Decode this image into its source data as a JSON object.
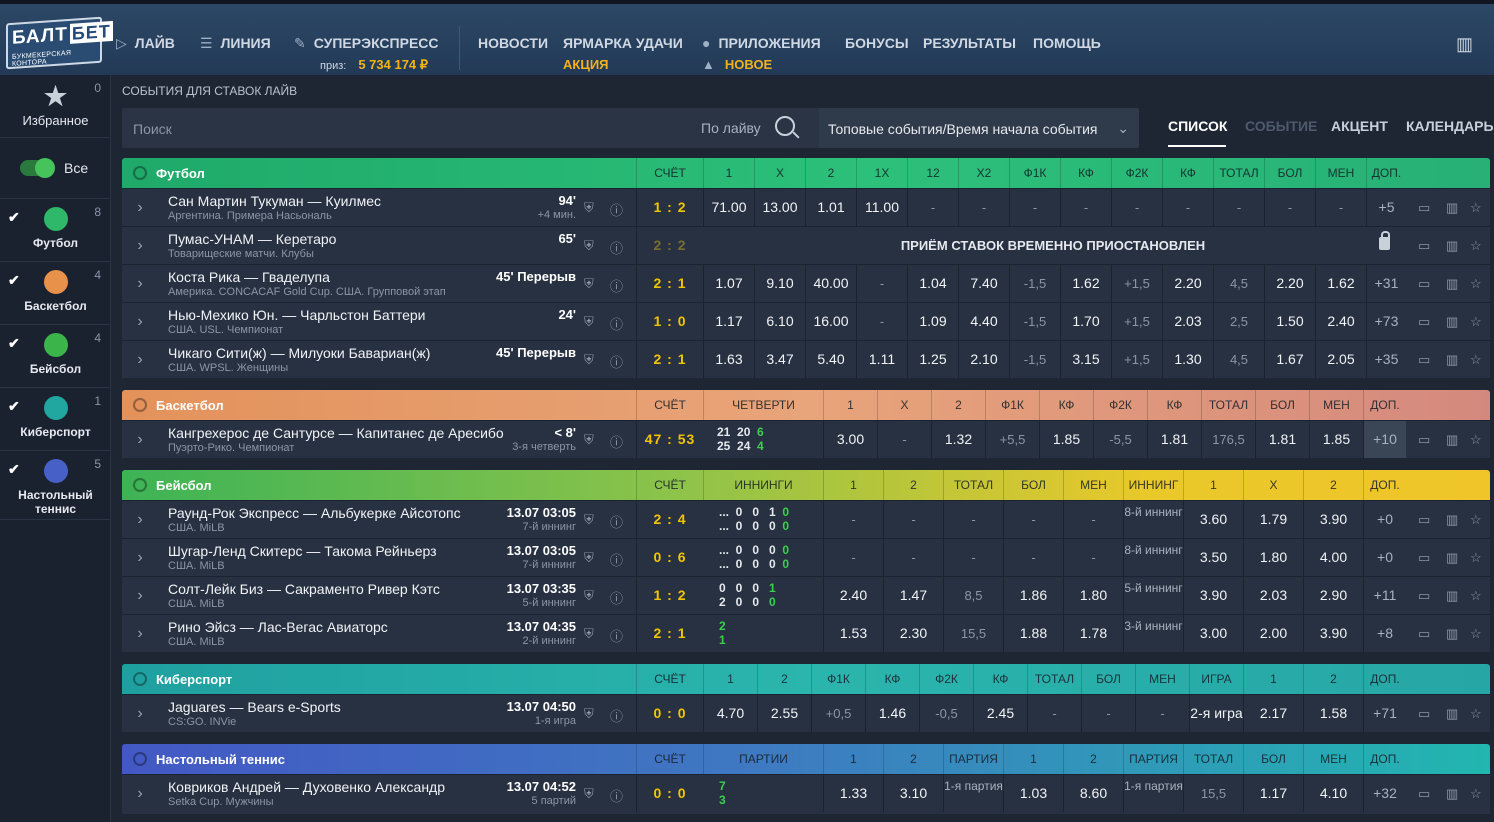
{
  "logo": {
    "word1": "БАЛТ",
    "word2": "БЕТ",
    "tagline": "БУКМЕКЕРСКАЯ КОНТОРА"
  },
  "nav": {
    "live": "ЛАЙВ",
    "line": "ЛИНИЯ",
    "superexpress": "СУПЕРЭКСПРЕСС",
    "prize_label": "приз:",
    "prize_value": "5 734 174 ₽",
    "news": "НОВОСТИ",
    "fair": "ЯРМАРКА УДАЧИ",
    "fair_sub": "АКЦИЯ",
    "apps": "ПРИЛОЖЕНИЯ",
    "apps_sub": "НОВОЕ",
    "bonuses": "БОНУСЫ",
    "results": "РЕЗУЛЬТАТЫ",
    "help": "ПОМОЩЬ"
  },
  "sidebar": {
    "fav_label": "Избранное",
    "fav_count": "0",
    "all_label": "Все",
    "sports": [
      {
        "label": "Футбол",
        "count": "8",
        "color": "#2fb86a"
      },
      {
        "label": "Баскетбол",
        "count": "4",
        "color": "#e8914b"
      },
      {
        "label": "Бейсбол",
        "count": "4",
        "color": "#3bb54a"
      },
      {
        "label": "Киберспорт",
        "count": "1",
        "color": "#21a7a0"
      },
      {
        "label": "Настольный теннис",
        "count": "5",
        "color": "#4660c8"
      }
    ]
  },
  "main": {
    "title": "СОБЫТИЯ ДЛЯ СТАВОК ЛАЙВ",
    "search_placeholder": "Поиск",
    "search_scope": "По лайву",
    "sort": "Топовые события/Время начала события",
    "views": [
      "СПИСОК",
      "СОБЫТИЕ",
      "АКЦЕНТ",
      "КАЛЕНДАРЬ"
    ]
  },
  "football": {
    "title": "Футбол",
    "cols": [
      "СЧЁТ",
      "1",
      "X",
      "2",
      "1X",
      "12",
      "X2",
      "Ф1К",
      "КФ",
      "Ф2К",
      "КФ",
      "ТОТАЛ",
      "БОЛ",
      "МЕН",
      "ДОП."
    ],
    "suspended": "ПРИЁМ СТАВОК ВРЕМЕННО ПРИОСТАНОВЛЕН",
    "rows": [
      {
        "teams": "Сан Мартин Тукуман — Куилмес",
        "league": "Аргентина. Примера Насьональ",
        "time": "94'",
        "time2": "+4 мин.",
        "score": "1 : 2",
        "odds": [
          "71.00",
          "13.00",
          "1.01",
          "11.00",
          "-",
          "-",
          "-",
          "-",
          "-",
          "-",
          "-",
          "-",
          "-"
        ],
        "plus": "+5"
      },
      {
        "teams": "Пумас-УНАМ — Керетаро",
        "league": "Товарищеские матчи. Клубы",
        "time": "65'",
        "time2": "",
        "score": "2 : 2",
        "plus": ""
      },
      {
        "teams": "Коста Рика — Гваделупа",
        "league": "Америка. CONCACAF Gold Cup. США. Групповой этап",
        "time": "45' Перерыв",
        "time2": "",
        "score": "2 : 1",
        "odds": [
          "1.07",
          "9.10",
          "40.00",
          "-",
          "1.04",
          "7.40",
          "-1,5",
          "1.62",
          "+1,5",
          "2.20",
          "4,5",
          "2.20",
          "1.62"
        ],
        "plus": "+31"
      },
      {
        "teams": "Нью-Мехико Юн. — Чарльстон Баттери",
        "league": "США. USL. Чемпионат",
        "time": "24'",
        "time2": "",
        "score": "1 : 0",
        "odds": [
          "1.17",
          "6.10",
          "16.00",
          "-",
          "1.09",
          "4.40",
          "-1,5",
          "1.70",
          "+1,5",
          "2.03",
          "2,5",
          "1.50",
          "2.40"
        ],
        "plus": "+73"
      },
      {
        "teams": "Чикаго Сити(ж) — Милуоки Бавариан(ж)",
        "league": "США. WPSL. Женщины",
        "time": "45' Перерыв",
        "time2": "",
        "score": "2 : 1",
        "odds": [
          "1.63",
          "3.47",
          "5.40",
          "1.11",
          "1.25",
          "2.10",
          "-1,5",
          "3.15",
          "+1,5",
          "1.30",
          "4,5",
          "1.67",
          "2.05"
        ],
        "plus": "+35"
      }
    ]
  },
  "basketball": {
    "title": "Баскетбол",
    "cols": [
      "СЧЁТ",
      "ЧЕТВЕРТИ",
      "1",
      "X",
      "2",
      "Ф1К",
      "КФ",
      "Ф2К",
      "КФ",
      "ТОТАЛ",
      "БОЛ",
      "МЕН",
      "ДОП."
    ],
    "rows": [
      {
        "teams": "Кангрехерос де Сантурсе — Капитанес де Аресибо",
        "league": "Пуэрто-Рико. Чемпионат",
        "time": "< 8'",
        "time2": "3-я четверть",
        "score": "47 : 53",
        "q1": "21  20  ",
        "q1g": "6",
        "q2": "25  24  ",
        "q2g": "4",
        "odds": [
          "3.00",
          "-",
          "1.32",
          "+5,5",
          "1.85",
          "-5,5",
          "1.81",
          "176,5",
          "1.81",
          "1.85"
        ],
        "plus": "+10"
      }
    ]
  },
  "baseball": {
    "title": "Бейсбол",
    "cols": [
      "СЧЁТ",
      "ИННИНГИ",
      "1",
      "2",
      "ТОТАЛ",
      "БОЛ",
      "МЕН",
      "ИННИНГ",
      "1",
      "X",
      "2",
      "ДОП."
    ],
    "rows": [
      {
        "teams": "Раунд-Рок Экспресс — Альбукерке Айсотопс",
        "league": "США. MiLB",
        "time": "13.07 03:05",
        "time2": "7-й иннинг",
        "score": "2 : 4",
        "l1": "...  0   0   1  ",
        "l1g": "0",
        "l2": "...  0   0   0  ",
        "l2g": "0",
        "odds": [
          "-",
          "-",
          "-",
          "-",
          "-"
        ],
        "inn": "8-й иннинг",
        "o2": [
          "3.60",
          "1.79",
          "3.90"
        ],
        "plus": "+0"
      },
      {
        "teams": "Шугар-Ленд Скитерс — Такома Рейньерз",
        "league": "США. MiLB",
        "time": "13.07 03:05",
        "time2": "7-й иннинг",
        "score": "0 : 6",
        "l1": "...  0   0   0  ",
        "l1g": "0",
        "l2": "...  0   0   0  ",
        "l2g": "0",
        "odds": [
          "-",
          "-",
          "-",
          "-",
          "-"
        ],
        "inn": "8-й иннинг",
        "o2": [
          "3.50",
          "1.80",
          "4.00"
        ],
        "plus": "+0"
      },
      {
        "teams": "Солт-Лейк Биз — Сакраменто Ривер Кэтс",
        "league": "США. MiLB",
        "time": "13.07 03:35",
        "time2": "5-й иннинг",
        "score": "1 : 2",
        "l1": "0   0   0   ",
        "l1g": "1",
        "l2": "2   0   0   ",
        "l2g": "0",
        "odds": [
          "2.40",
          "1.47",
          "8,5",
          "1.86",
          "1.80"
        ],
        "inn": "5-й иннинг",
        "o2": [
          "3.90",
          "2.03",
          "2.90"
        ],
        "plus": "+11"
      },
      {
        "teams": "Рино Эйсз — Лас-Вегас Авиаторс",
        "league": "США. MiLB",
        "time": "13.07 04:35",
        "time2": "2-й иннинг",
        "score": "2 : 1",
        "l1": "",
        "l1g": "2",
        "l2": "",
        "l2g": "1",
        "odds": [
          "1.53",
          "2.30",
          "15,5",
          "1.88",
          "1.78"
        ],
        "inn": "3-й иннинг",
        "o2": [
          "3.00",
          "2.00",
          "3.90"
        ],
        "plus": "+8"
      }
    ]
  },
  "esports": {
    "title": "Киберспорт",
    "cols": [
      "СЧЁТ",
      "1",
      "2",
      "Ф1К",
      "КФ",
      "Ф2К",
      "КФ",
      "ТОТАЛ",
      "БОЛ",
      "МЕН",
      "ИГРА",
      "1",
      "2",
      "ДОП."
    ],
    "rows": [
      {
        "teams": "Jaguares — Bears e-Sports",
        "league": "CS:GO. INVie",
        "time": "13.07 04:50",
        "time2": "1-я игра",
        "score": "0 : 0",
        "odds": [
          "4.70",
          "2.55",
          "+0,5",
          "1.46",
          "-0,5",
          "2.45",
          "-",
          "-",
          "-",
          "2-я игра",
          "2.17",
          "1.58"
        ],
        "plus": "+71"
      }
    ]
  },
  "tabletennis": {
    "title": "Настольный теннис",
    "cols": [
      "СЧЁТ",
      "ПАРТИИ",
      "1",
      "2",
      "ПАРТИЯ",
      "1",
      "2",
      "ПАРТИЯ",
      "ТОТАЛ",
      "БОЛ",
      "МЕН",
      "ДОП."
    ],
    "rows": [
      {
        "teams": "Ковриков Андрей — Духовенко Александр",
        "league": "Setka Cup. Мужчины",
        "time": "13.07 04:52",
        "time2": "5 партий",
        "score": "0 : 0",
        "p1": "7",
        "p2": "3",
        "odds": [
          "1.33",
          "3.10",
          "1-я партия",
          "1.03",
          "8.60",
          "1-я партия",
          "15,5",
          "1.17",
          "4.10"
        ],
        "plus": "+32"
      }
    ]
  }
}
